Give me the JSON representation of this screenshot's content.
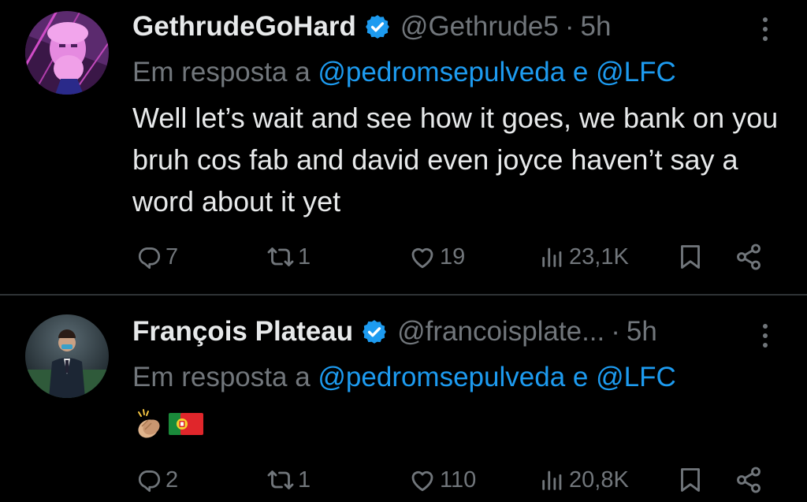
{
  "tweets": [
    {
      "name": "GethrudeGoHard",
      "handle": "@Gethrude5",
      "separator": "·",
      "time": "5h",
      "reply_prefix": "Em resposta a",
      "reply_user1": "@pedromsepulveda",
      "reply_and": "e",
      "reply_user2": "@LFC",
      "text": "Well let’s wait and see how it goes, we bank on you bruh cos fab and david even joyce haven’t say a word about it yet",
      "replies": "7",
      "retweets": "1",
      "likes": "19",
      "views": "23,1K"
    },
    {
      "name": "François Plateau",
      "handle": "@francoisplate...",
      "separator": "·",
      "time": "5h",
      "reply_prefix": "Em resposta a",
      "reply_user1": "@pedromsepulveda",
      "reply_and": "e",
      "reply_user2": "@LFC",
      "emojis": [
        "clapping-hands-emoji",
        "portugal-flag-emoji"
      ],
      "replies": "2",
      "retweets": "1",
      "likes": "110",
      "views": "20,8K"
    }
  ],
  "colors": {
    "background": "#000000",
    "text": "#e7e9ea",
    "muted": "#71767b",
    "link": "#1d9bf0",
    "verified": "#1d9bf0",
    "divider": "#2f3336"
  },
  "icons": [
    "verified-badge-icon",
    "more-options-icon",
    "reply-icon",
    "retweet-icon",
    "like-icon",
    "views-icon",
    "bookmark-icon",
    "share-icon"
  ]
}
